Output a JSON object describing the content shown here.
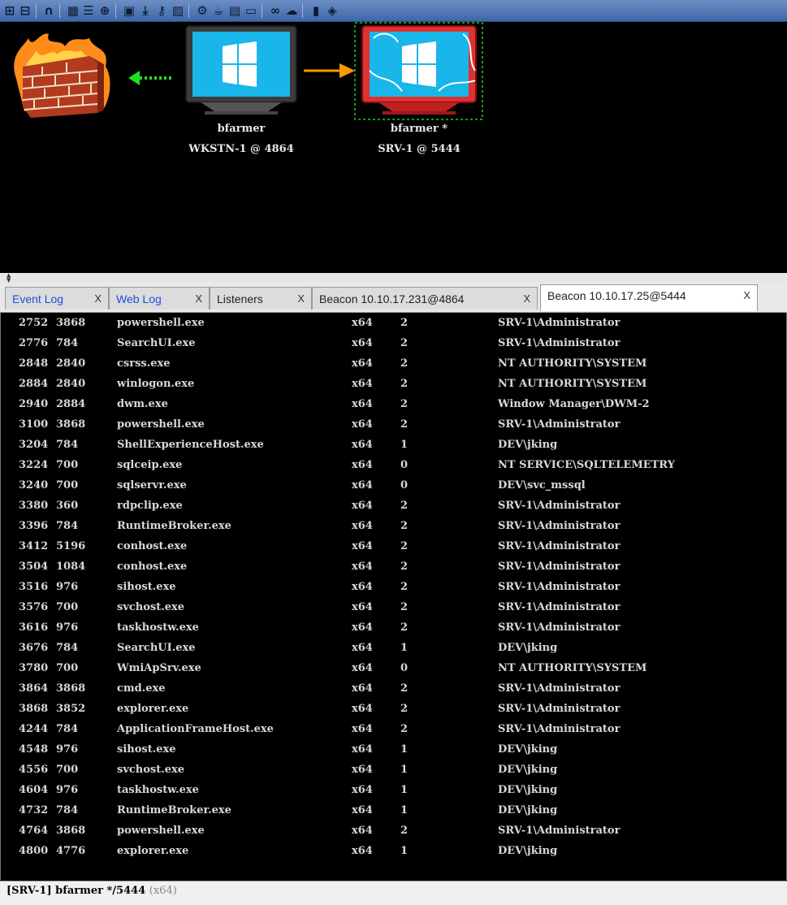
{
  "toolbar": {
    "icons": [
      "connect-icon",
      "disconnect-icon",
      "headset-icon",
      "graph-view-icon",
      "list-view-icon",
      "target-icon",
      "credentials-icon",
      "download-icon",
      "key-icon",
      "screenshot-icon",
      "settings-icon",
      "coffee-icon",
      "document-icon",
      "terminal-icon",
      "link-icon",
      "cloud-icon",
      "book-icon",
      "cube-icon"
    ]
  },
  "graph": {
    "nodes": [
      {
        "user": "bfarmer",
        "host": "WKSTN-1 @ 4864"
      },
      {
        "user": "bfarmer *",
        "host": "SRV-1 @ 5444"
      }
    ]
  },
  "tabs": [
    {
      "label": "Event Log",
      "close": "X"
    },
    {
      "label": "Web Log",
      "close": "X"
    },
    {
      "label": "Listeners",
      "close": "X"
    },
    {
      "label": "Beacon 10.10.17.231@4864",
      "close": "X"
    },
    {
      "label": "Beacon 10.10.17.25@5444",
      "close": "X"
    }
  ],
  "console": {
    "rows": [
      [
        "2752",
        "3868",
        "powershell.exe",
        "x64",
        "2",
        "SRV-1\\Administrator"
      ],
      [
        "2776",
        "784",
        "SearchUI.exe",
        "x64",
        "2",
        "SRV-1\\Administrator"
      ],
      [
        "2848",
        "2840",
        "csrss.exe",
        "x64",
        "2",
        "NT AUTHORITY\\SYSTEM"
      ],
      [
        "2884",
        "2840",
        "winlogon.exe",
        "x64",
        "2",
        "NT AUTHORITY\\SYSTEM"
      ],
      [
        "2940",
        "2884",
        "dwm.exe",
        "x64",
        "2",
        "Window Manager\\DWM-2"
      ],
      [
        "3100",
        "3868",
        "powershell.exe",
        "x64",
        "2",
        "SRV-1\\Administrator"
      ],
      [
        "3204",
        "784",
        "ShellExperienceHost.exe",
        "x64",
        "1",
        "DEV\\jking"
      ],
      [
        "3224",
        "700",
        "sqlceip.exe",
        "x64",
        "0",
        "NT SERVICE\\SQLTELEMETRY"
      ],
      [
        "3240",
        "700",
        "sqlservr.exe",
        "x64",
        "0",
        "DEV\\svc_mssql"
      ],
      [
        "3380",
        "360",
        "rdpclip.exe",
        "x64",
        "2",
        "SRV-1\\Administrator"
      ],
      [
        "3396",
        "784",
        "RuntimeBroker.exe",
        "x64",
        "2",
        "SRV-1\\Administrator"
      ],
      [
        "3412",
        "5196",
        "conhost.exe",
        "x64",
        "2",
        "SRV-1\\Administrator"
      ],
      [
        "3504",
        "1084",
        "conhost.exe",
        "x64",
        "2",
        "SRV-1\\Administrator"
      ],
      [
        "3516",
        "976",
        "sihost.exe",
        "x64",
        "2",
        "SRV-1\\Administrator"
      ],
      [
        "3576",
        "700",
        "svchost.exe",
        "x64",
        "2",
        "SRV-1\\Administrator"
      ],
      [
        "3616",
        "976",
        "taskhostw.exe",
        "x64",
        "2",
        "SRV-1\\Administrator"
      ],
      [
        "3676",
        "784",
        "SearchUI.exe",
        "x64",
        "1",
        "DEV\\jking"
      ],
      [
        "3780",
        "700",
        "WmiApSrv.exe",
        "x64",
        "0",
        "NT AUTHORITY\\SYSTEM"
      ],
      [
        "3864",
        "3868",
        "cmd.exe",
        "x64",
        "2",
        "SRV-1\\Administrator"
      ],
      [
        "3868",
        "3852",
        "explorer.exe",
        "x64",
        "2",
        "SRV-1\\Administrator"
      ],
      [
        "4244",
        "784",
        "ApplicationFrameHost.exe",
        "x64",
        "2",
        "SRV-1\\Administrator"
      ],
      [
        "4548",
        "976",
        "sihost.exe",
        "x64",
        "1",
        "DEV\\jking"
      ],
      [
        "4556",
        "700",
        "svchost.exe",
        "x64",
        "1",
        "DEV\\jking"
      ],
      [
        "4604",
        "976",
        "taskhostw.exe",
        "x64",
        "1",
        "DEV\\jking"
      ],
      [
        "4732",
        "784",
        "RuntimeBroker.exe",
        "x64",
        "1",
        "DEV\\jking"
      ],
      [
        "4764",
        "3868",
        "powershell.exe",
        "x64",
        "2",
        "SRV-1\\Administrator"
      ],
      [
        "4800",
        "4776",
        "explorer.exe",
        "x64",
        "1",
        "DEV\\jking"
      ]
    ]
  },
  "status": {
    "prefix": "[SRV-1] bfarmer */5444",
    "arch": "(x64)"
  },
  "colors": {
    "arrow_green": "#22dd22",
    "arrow_orange": "#ff9900",
    "selection": "#22cc22",
    "screen_blue": "#19b6ea",
    "compromised_red": "#e03030"
  }
}
